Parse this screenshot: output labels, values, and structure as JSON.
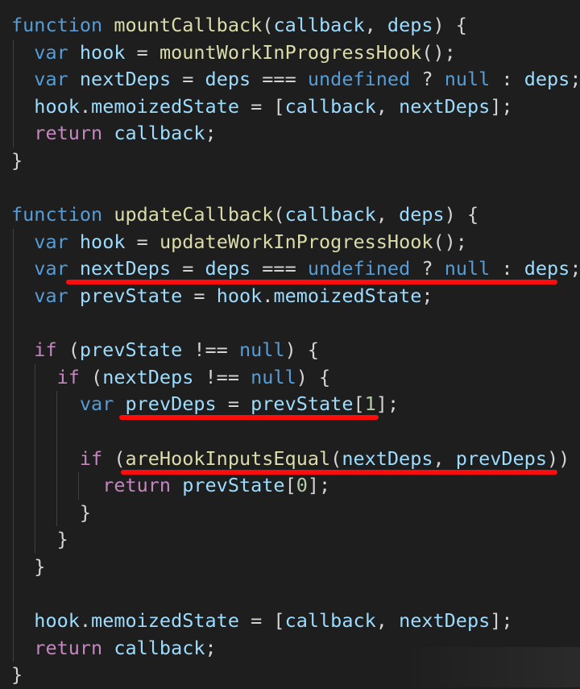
{
  "code": {
    "lines": [
      [
        {
          "t": "function",
          "c": "keyword"
        },
        {
          "t": " ",
          "c": "punct"
        },
        {
          "t": "mountCallback",
          "c": "function"
        },
        {
          "t": "(",
          "c": "punct"
        },
        {
          "t": "callback",
          "c": "variable"
        },
        {
          "t": ", ",
          "c": "punct"
        },
        {
          "t": "deps",
          "c": "variable"
        },
        {
          "t": ") {",
          "c": "punct"
        }
      ],
      [
        {
          "t": "  ",
          "c": "punct"
        },
        {
          "t": "var",
          "c": "keyword"
        },
        {
          "t": " ",
          "c": "punct"
        },
        {
          "t": "hook",
          "c": "variable"
        },
        {
          "t": " = ",
          "c": "punct"
        },
        {
          "t": "mountWorkInProgressHook",
          "c": "function"
        },
        {
          "t": "();",
          "c": "punct"
        }
      ],
      [
        {
          "t": "  ",
          "c": "punct"
        },
        {
          "t": "var",
          "c": "keyword"
        },
        {
          "t": " ",
          "c": "punct"
        },
        {
          "t": "nextDeps",
          "c": "variable"
        },
        {
          "t": " = ",
          "c": "punct"
        },
        {
          "t": "deps",
          "c": "variable"
        },
        {
          "t": " === ",
          "c": "punct"
        },
        {
          "t": "undefined",
          "c": "keyword"
        },
        {
          "t": " ? ",
          "c": "punct"
        },
        {
          "t": "null",
          "c": "keyword"
        },
        {
          "t": " : ",
          "c": "punct"
        },
        {
          "t": "deps",
          "c": "variable"
        },
        {
          "t": ";",
          "c": "punct"
        }
      ],
      [
        {
          "t": "  ",
          "c": "punct"
        },
        {
          "t": "hook",
          "c": "variable"
        },
        {
          "t": ".",
          "c": "punct"
        },
        {
          "t": "memoizedState",
          "c": "variable"
        },
        {
          "t": " = [",
          "c": "punct"
        },
        {
          "t": "callback",
          "c": "variable"
        },
        {
          "t": ", ",
          "c": "punct"
        },
        {
          "t": "nextDeps",
          "c": "variable"
        },
        {
          "t": "];",
          "c": "punct"
        }
      ],
      [
        {
          "t": "  ",
          "c": "punct"
        },
        {
          "t": "return",
          "c": "control"
        },
        {
          "t": " ",
          "c": "punct"
        },
        {
          "t": "callback",
          "c": "variable"
        },
        {
          "t": ";",
          "c": "punct"
        }
      ],
      [
        {
          "t": "}",
          "c": "punct"
        }
      ],
      [],
      [
        {
          "t": "function",
          "c": "keyword"
        },
        {
          "t": " ",
          "c": "punct"
        },
        {
          "t": "updateCallback",
          "c": "function"
        },
        {
          "t": "(",
          "c": "punct"
        },
        {
          "t": "callback",
          "c": "variable"
        },
        {
          "t": ", ",
          "c": "punct"
        },
        {
          "t": "deps",
          "c": "variable"
        },
        {
          "t": ") {",
          "c": "punct"
        }
      ],
      [
        {
          "t": "  ",
          "c": "punct"
        },
        {
          "t": "var",
          "c": "keyword"
        },
        {
          "t": " ",
          "c": "punct"
        },
        {
          "t": "hook",
          "c": "variable"
        },
        {
          "t": " = ",
          "c": "punct"
        },
        {
          "t": "updateWorkInProgressHook",
          "c": "function"
        },
        {
          "t": "();",
          "c": "punct"
        }
      ],
      [
        {
          "t": "  ",
          "c": "punct"
        },
        {
          "t": "var",
          "c": "keyword"
        },
        {
          "t": " ",
          "c": "punct"
        },
        {
          "t": "nextDeps",
          "c": "variable"
        },
        {
          "t": " = ",
          "c": "punct"
        },
        {
          "t": "deps",
          "c": "variable"
        },
        {
          "t": " === ",
          "c": "punct"
        },
        {
          "t": "undefined",
          "c": "keyword"
        },
        {
          "t": " ? ",
          "c": "punct"
        },
        {
          "t": "null",
          "c": "keyword"
        },
        {
          "t": " : ",
          "c": "punct"
        },
        {
          "t": "deps",
          "c": "variable"
        },
        {
          "t": ";",
          "c": "punct"
        }
      ],
      [
        {
          "t": "  ",
          "c": "punct"
        },
        {
          "t": "var",
          "c": "keyword"
        },
        {
          "t": " ",
          "c": "punct"
        },
        {
          "t": "prevState",
          "c": "variable"
        },
        {
          "t": " = ",
          "c": "punct"
        },
        {
          "t": "hook",
          "c": "variable"
        },
        {
          "t": ".",
          "c": "punct"
        },
        {
          "t": "memoizedState",
          "c": "variable"
        },
        {
          "t": ";",
          "c": "punct"
        }
      ],
      [],
      [
        {
          "t": "  ",
          "c": "punct"
        },
        {
          "t": "if",
          "c": "control"
        },
        {
          "t": " (",
          "c": "punct"
        },
        {
          "t": "prevState",
          "c": "variable"
        },
        {
          "t": " !== ",
          "c": "punct"
        },
        {
          "t": "null",
          "c": "keyword"
        },
        {
          "t": ") {",
          "c": "punct"
        }
      ],
      [
        {
          "t": "    ",
          "c": "punct"
        },
        {
          "t": "if",
          "c": "control"
        },
        {
          "t": " (",
          "c": "punct"
        },
        {
          "t": "nextDeps",
          "c": "variable"
        },
        {
          "t": " !== ",
          "c": "punct"
        },
        {
          "t": "null",
          "c": "keyword"
        },
        {
          "t": ") {",
          "c": "punct"
        }
      ],
      [
        {
          "t": "      ",
          "c": "punct"
        },
        {
          "t": "var",
          "c": "keyword"
        },
        {
          "t": " ",
          "c": "punct"
        },
        {
          "t": "prevDeps",
          "c": "variable"
        },
        {
          "t": " = ",
          "c": "punct"
        },
        {
          "t": "prevState",
          "c": "variable"
        },
        {
          "t": "[",
          "c": "punct"
        },
        {
          "t": "1",
          "c": "number"
        },
        {
          "t": "];",
          "c": "punct"
        }
      ],
      [],
      [
        {
          "t": "      ",
          "c": "punct"
        },
        {
          "t": "if",
          "c": "control"
        },
        {
          "t": " (",
          "c": "punct"
        },
        {
          "t": "areHookInputsEqual",
          "c": "function"
        },
        {
          "t": "(",
          "c": "punct"
        },
        {
          "t": "nextDeps",
          "c": "variable"
        },
        {
          "t": ", ",
          "c": "punct"
        },
        {
          "t": "prevDeps",
          "c": "variable"
        },
        {
          "t": ")) {",
          "c": "punct"
        }
      ],
      [
        {
          "t": "        ",
          "c": "punct"
        },
        {
          "t": "return",
          "c": "control"
        },
        {
          "t": " ",
          "c": "punct"
        },
        {
          "t": "prevState",
          "c": "variable"
        },
        {
          "t": "[",
          "c": "punct"
        },
        {
          "t": "0",
          "c": "number"
        },
        {
          "t": "];",
          "c": "punct"
        }
      ],
      [
        {
          "t": "      }",
          "c": "punct"
        }
      ],
      [
        {
          "t": "    }",
          "c": "punct"
        }
      ],
      [
        {
          "t": "  }",
          "c": "punct"
        }
      ],
      [],
      [
        {
          "t": "  ",
          "c": "punct"
        },
        {
          "t": "hook",
          "c": "variable"
        },
        {
          "t": ".",
          "c": "punct"
        },
        {
          "t": "memoizedState",
          "c": "variable"
        },
        {
          "t": " = [",
          "c": "punct"
        },
        {
          "t": "callback",
          "c": "variable"
        },
        {
          "t": ", ",
          "c": "punct"
        },
        {
          "t": "nextDeps",
          "c": "variable"
        },
        {
          "t": "];",
          "c": "punct"
        }
      ],
      [
        {
          "t": "  ",
          "c": "punct"
        },
        {
          "t": "return",
          "c": "control"
        },
        {
          "t": " ",
          "c": "punct"
        },
        {
          "t": "callback",
          "c": "variable"
        },
        {
          "t": ";",
          "c": "punct"
        }
      ],
      [
        {
          "t": "}",
          "c": "punct"
        }
      ]
    ]
  },
  "colors": {
    "background": "#1e1e1e",
    "keyword": "#569cd6",
    "control": "#c586c0",
    "function": "#dcdcaa",
    "variable": "#9cdcfe",
    "number": "#b5cea8",
    "punct": "#d4d4d4",
    "highlight_underline": "#ff0d0d"
  },
  "annotations": {
    "underlined_lines": [
      9,
      14,
      16
    ]
  }
}
